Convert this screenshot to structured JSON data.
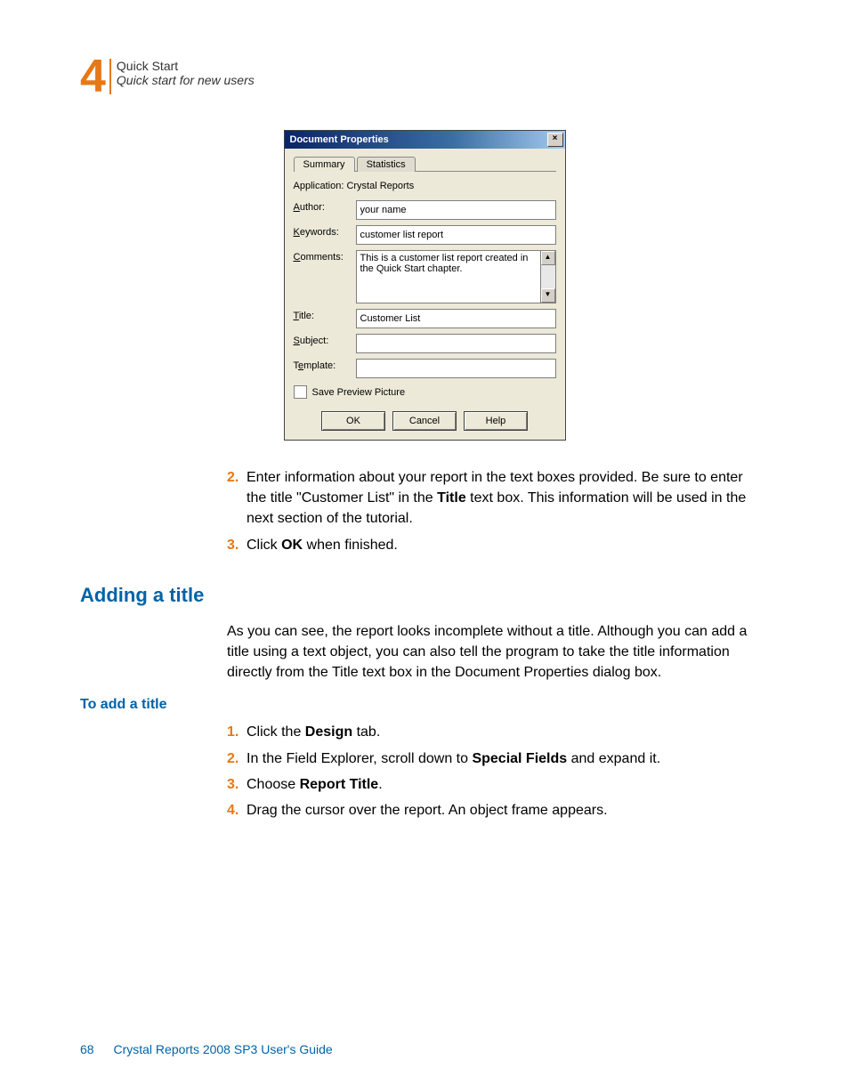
{
  "header": {
    "chapter_num": "4",
    "chapter_title": "Quick Start",
    "chapter_sub": "Quick start for new users"
  },
  "dialog": {
    "title": "Document Properties",
    "close": "×",
    "tabs": {
      "summary": "Summary",
      "statistics": "Statistics"
    },
    "app_label": "Application:",
    "app_value": "Crystal Reports",
    "author_label": "Author:",
    "author_u": "A",
    "author_rest": "uthor:",
    "author_value": "your name",
    "keywords_label": "Keywords:",
    "keywords_u": "K",
    "keywords_rest": "eywords:",
    "keywords_value": "customer list report",
    "comments_label": "Comments:",
    "comments_u": "C",
    "comments_rest": "omments:",
    "comments_value": "This is a customer list report created in the Quick Start chapter.",
    "scroll_up": "▲",
    "scroll_down": "▼",
    "title_label": "Title:",
    "title_u": "T",
    "title_rest": "itle:",
    "title_value": "Customer List",
    "subject_label": "Subject:",
    "subject_u": "S",
    "subject_rest": "ubject:",
    "subject_value": "",
    "template_label": "Template:",
    "template_pre": "T",
    "template_u": "e",
    "template_rest": "mplate:",
    "template_value": "",
    "save_label": "Save Preview Picture",
    "save_pre": "Sa",
    "save_u": "v",
    "save_rest": "e Preview Picture",
    "ok": "OK",
    "cancel": "Cancel",
    "help": "Help",
    "help_u": "H",
    "help_rest": "elp"
  },
  "body": {
    "step2_num": "2.",
    "step2_text_a": "Enter information about your report in the text boxes provided. Be sure to enter the title \"Customer List\" in the ",
    "step2_bold": "Title",
    "step2_text_b": " text box. This information will be used in the next section of the tutorial.",
    "step3_num": "3.",
    "step3_text_a": "Click ",
    "step3_bold": "OK",
    "step3_text_b": " when finished.",
    "h2": "Adding a title",
    "para": "As you can see, the report looks incomplete without a title. Although you can add a title using a text object, you can also tell the program to take the title information directly from the Title text box in the Document Properties dialog box.",
    "sub": "To add a title",
    "i1_num": "1.",
    "i1_a": "Click the ",
    "i1_b": "Design",
    "i1_c": " tab.",
    "i2_num": "2.",
    "i2_a": "In the Field Explorer, scroll down to ",
    "i2_b": "Special Fields",
    "i2_c": " and expand it.",
    "i3_num": "3.",
    "i3_a": "Choose ",
    "i3_b": "Report Title",
    "i3_c": ".",
    "i4_num": "4.",
    "i4_a": "Drag the cursor over the report. An object frame appears."
  },
  "footer": {
    "page": "68",
    "book": "Crystal Reports 2008 SP3 User's Guide"
  }
}
